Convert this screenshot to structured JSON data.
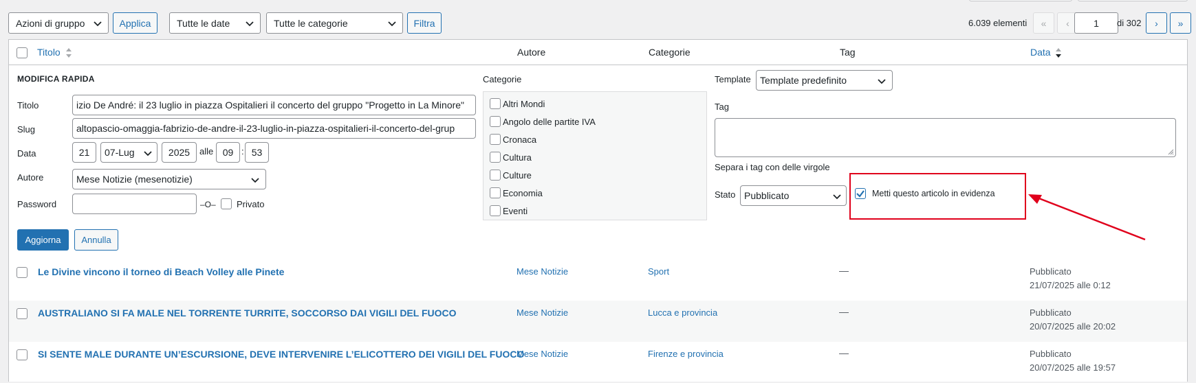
{
  "toolbar": {
    "bulk_actions": "Azioni di gruppo",
    "apply": "Applica",
    "dates": "Tutte le date",
    "categories": "Tutte le categorie",
    "filter": "Filtra",
    "count": "6.039 elementi",
    "first": "«",
    "prev": "‹",
    "page": "1",
    "of_pages": "di 302",
    "next": "›",
    "last": "»"
  },
  "table": {
    "col_title": "Titolo",
    "col_author": "Autore",
    "col_categories": "Categorie",
    "col_tag": "Tag",
    "col_date": "Data"
  },
  "quick_edit": {
    "heading": "MODIFICA RAPIDA",
    "title_label": "Titolo",
    "title_value": "izio De André: il 23 luglio in piazza Ospitalieri il concerto del gruppo \"Progetto in La Minore\"",
    "slug_label": "Slug",
    "slug_value": "altopascio-omaggia-fabrizio-de-andre-il-23-luglio-in-piazza-ospitalieri-il-concerto-del-grup",
    "date_label": "Data",
    "day": "21",
    "month": "07-Lug",
    "year": "2025",
    "at": "alle",
    "hour": "09",
    "colon": ":",
    "minute": "53",
    "author_label": "Autore",
    "author_value": "Mese Notizie (mesenotizie)",
    "password_label": "Password",
    "password_value": "",
    "or_label": "–O–",
    "private_label": "Privato",
    "categories_label": "Categorie",
    "categories": [
      "Altri Mondi",
      "Angolo delle partite IVA",
      "Cronaca",
      "Cultura",
      "Culture",
      "Economia",
      "Eventi"
    ],
    "template_label": "Template",
    "template_value": "Template predefinito",
    "tag_label": "Tag",
    "tag_hint": "Separa i tag con delle virgole",
    "status_label": "Stato",
    "status_value": "Pubblicato",
    "sticky_label": "Metti questo articolo in evidenza",
    "sticky_checked": true,
    "update_button": "Aggiorna",
    "cancel_button": "Annulla"
  },
  "rows": [
    {
      "title": "Le Divine vincono il torneo di Beach Volley alle Pinete",
      "author": "Mese Notizie",
      "category": "Sport",
      "tag": "—",
      "status": "Pubblicato",
      "date": "21/07/2025 alle 0:12"
    },
    {
      "title": "AUSTRALIANO SI FA MALE NEL TORRENTE TURRITE, SOCCORSO DAI VIGILI DEL FUOCO",
      "author": "Mese Notizie",
      "category": "Lucca e provincia",
      "tag": "—",
      "status": "Pubblicato",
      "date": "20/07/2025 alle 20:02"
    },
    {
      "title": "SI SENTE MALE DURANTE UN’ESCURSIONE, DEVE INTERVENIRE L’ELICOTTERO DEI VIGILI DEL FUOCO",
      "author": "Mese Notizie",
      "category": "Firenze e provincia",
      "tag": "—",
      "status": "Pubblicato",
      "date": "20/07/2025 alle 19:57"
    }
  ],
  "colors": {
    "accent": "#2271b1",
    "annotation": "#e0001b"
  }
}
